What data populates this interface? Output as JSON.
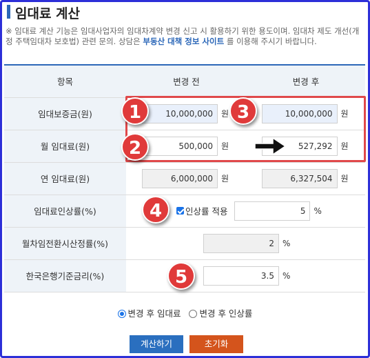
{
  "title": "임대료 계산",
  "notice": {
    "prefix": "※ 임대료 계산 기능은 임대사업자의 임대차계약 변경 신고 시 활용하기 위한 용도이며. 임대차 제도 개선(개정 주택임대차 보호법) 관련 문의. 상담은 ",
    "link": "부동산 대책 정보 사이트",
    "suffix": " 를 이용해 주시기 바랍니다."
  },
  "table": {
    "headers": [
      "항목",
      "변경 전",
      "변경 후"
    ],
    "rows": [
      {
        "label": "임대보증금(원)",
        "before": "10,000,000",
        "after": "10,000,000",
        "unit": "원"
      },
      {
        "label": "월 임대료(원)",
        "before": "500,000",
        "after": "527,292",
        "unit": "원"
      },
      {
        "label": "연 임대료(원)",
        "before": "6,000,000",
        "after": "6,327,504",
        "unit": "원"
      }
    ],
    "rate_row": {
      "label": "임대료인상률(%)",
      "checkbox_label": "인상률 적용",
      "value": "5",
      "unit": "%"
    },
    "conversion_row": {
      "label": "월차임전환시산정률(%)",
      "value": "2",
      "unit": "%"
    },
    "bank_row": {
      "label": "한국은행기준금리(%)",
      "value": "3.5",
      "unit": "%"
    }
  },
  "radios": [
    {
      "label": "변경 후 임대료",
      "selected": true
    },
    {
      "label": "변경 후 인상률",
      "selected": false
    }
  ],
  "buttons": {
    "calculate": "계산하기",
    "reset": "초기화"
  },
  "badges": [
    "1",
    "2",
    "3",
    "4",
    "5"
  ],
  "colors": {
    "accent": "#2b67b8",
    "badge": "#e03a3a",
    "calc_button": "#2a6fbf",
    "reset_button": "#d4541c",
    "frame": "#2d2fd8"
  }
}
